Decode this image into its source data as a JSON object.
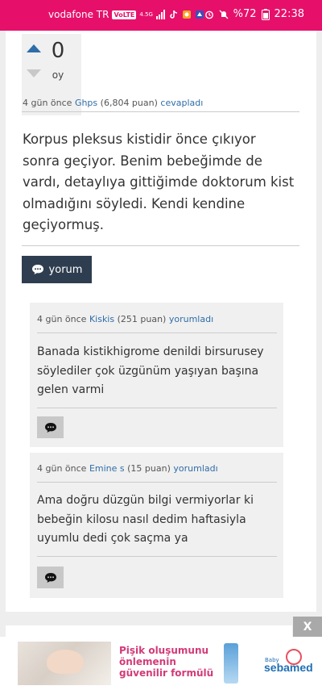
{
  "status_bar": {
    "carrier": "vodafone TR",
    "volte": "VoLTE",
    "network": "4.5G",
    "battery": "%72",
    "time": "22:38"
  },
  "answer": {
    "votes": "0",
    "votes_unit": "oy",
    "meta": {
      "when": "4 gün önce",
      "user": "Ghps",
      "points": "(6,804 puan)",
      "action": "cevapladı"
    },
    "text": "Korpus pleksus kistidir önce çıkıyor sonra geçiyor. Benim bebeğimde de vardı, detaylıya gittiğimde doktorum kist olmadığını söyledi. Kendi kendine geçiyormuş.",
    "comment_button_label": "yorum"
  },
  "comments": [
    {
      "when": "4 gün önce",
      "user": "Kiskis",
      "points": "(251 puan)",
      "action": "yorumladı",
      "text": "Banada kistikhigrome denildi birsurusey söylediler çok üzgünüm yaşıyan başına gelen varmi"
    },
    {
      "when": "4 gün önce",
      "user": "Emine s",
      "points": "(15 puan)",
      "action": "yorumladı",
      "text": "Ama doğru düzgün bilgi vermiyorlar ki bebeğin kilosu nasıl dedim haftasiyla uyumlu dedi çok saçma ya"
    }
  ],
  "ad": {
    "close_label": "X",
    "headline": "Pişik oluşumunu önlemenin güvenilir formülü",
    "brand_small": "Baby",
    "brand": "sebamed"
  },
  "colors": {
    "status_bar": "#e6106b",
    "link": "#2f6da8",
    "comment_button": "#2e3e50"
  }
}
